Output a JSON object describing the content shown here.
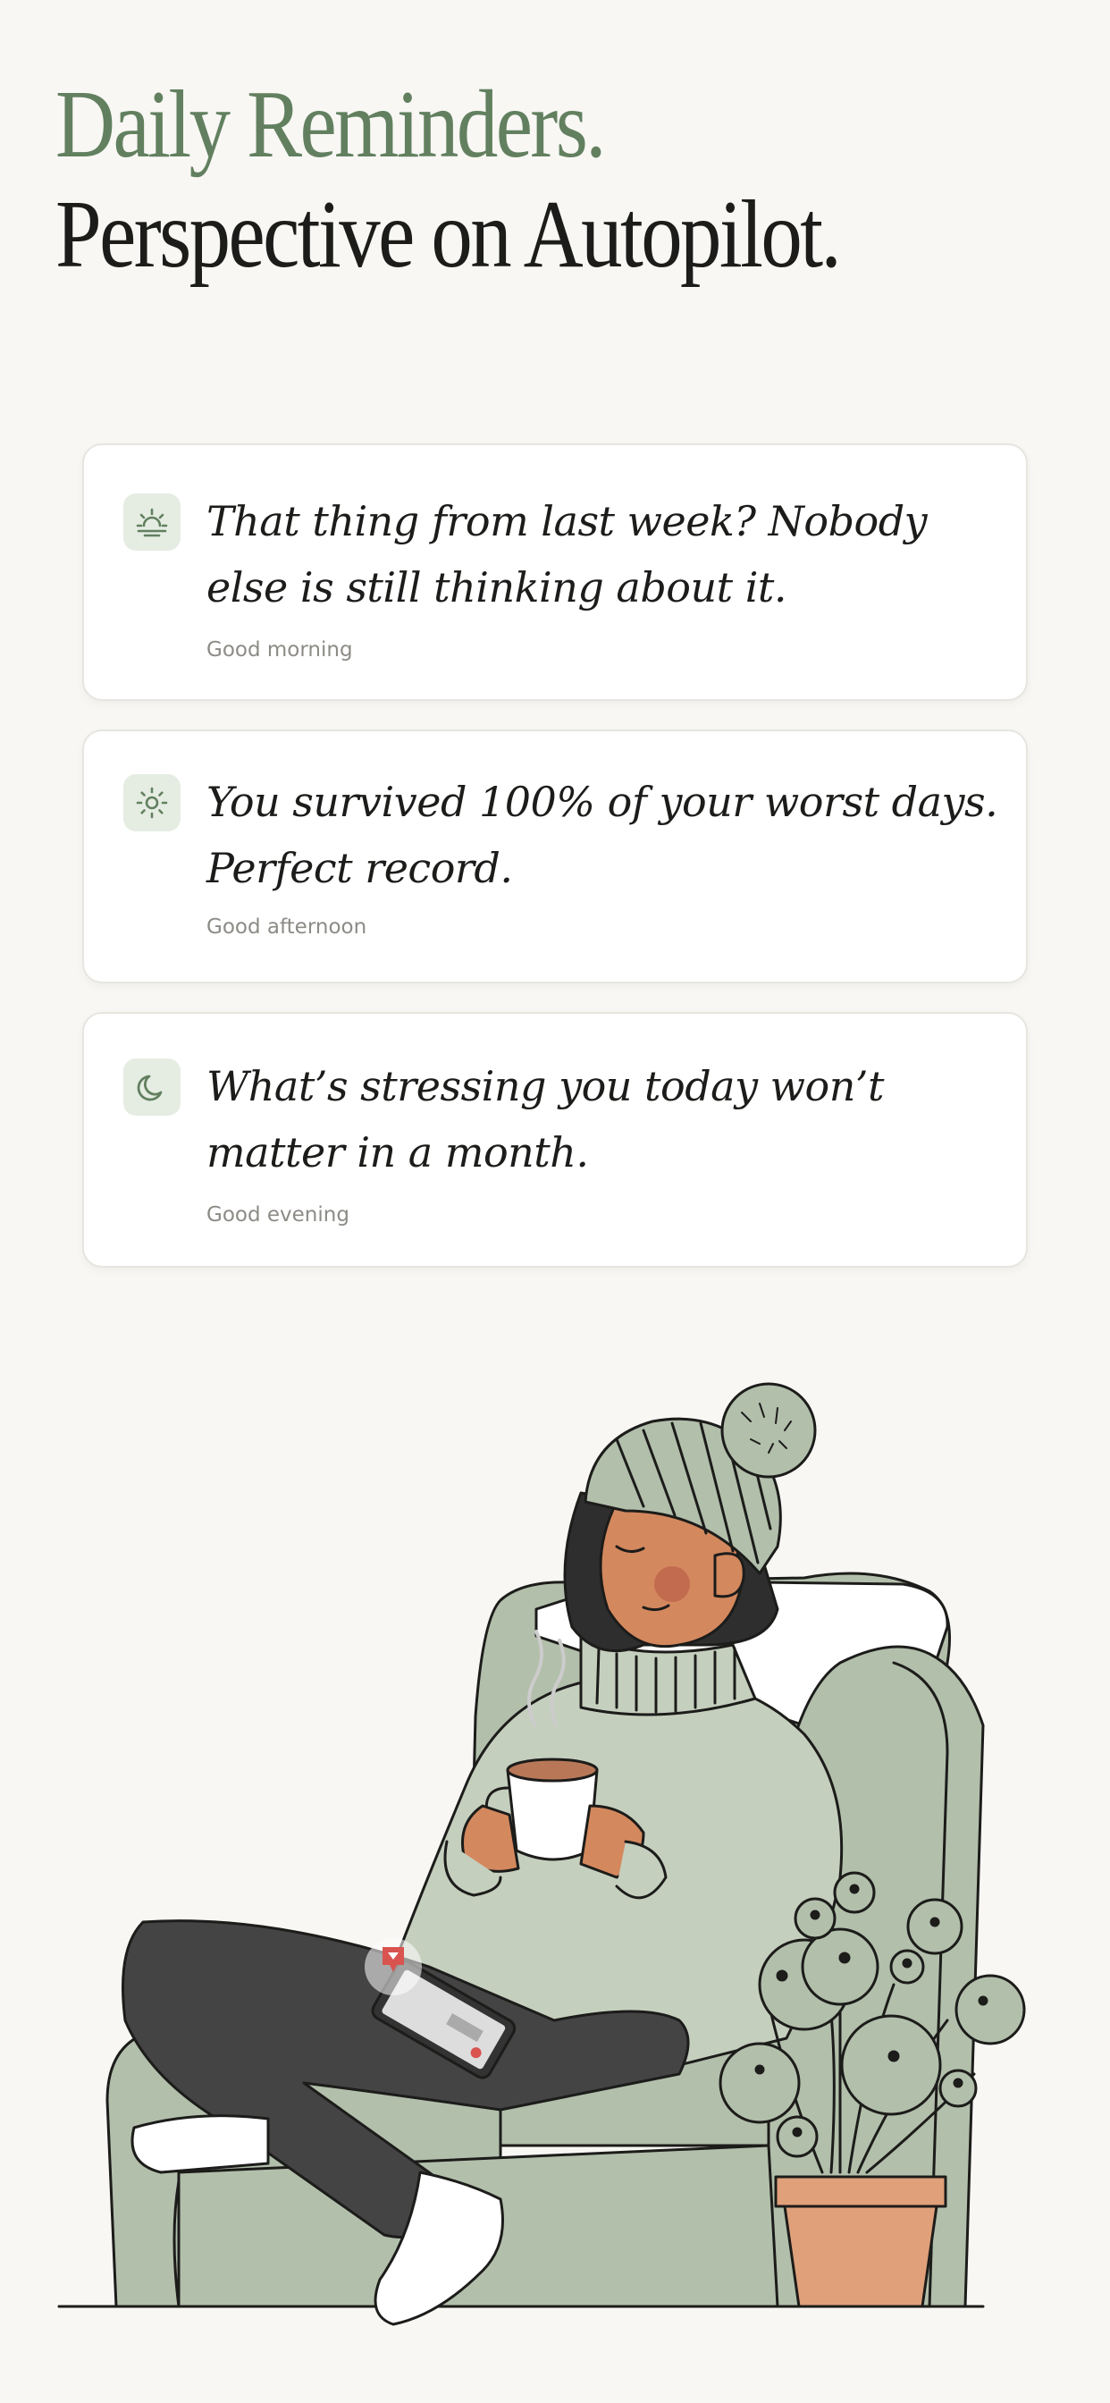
{
  "header": {
    "line1": "Daily Reminders.",
    "line2": "Perspective on Autopilot."
  },
  "reminders": [
    {
      "icon": "sunrise-icon",
      "text": "That thing from last week? Nobody else is still thinking about it.",
      "time_label": "Good morning"
    },
    {
      "icon": "sun-icon",
      "text": "You survived 100% of your worst days. Perfect record.",
      "time_label": "Good afternoon"
    },
    {
      "icon": "moon-icon",
      "text": "What’s stressing you today won’t matter in a month.",
      "time_label": "Good evening"
    }
  ],
  "colors": {
    "background": "#f8f7f4",
    "accent_green": "#62805f",
    "icon_bg": "#e5ede3",
    "text_dark": "#1c1c1a",
    "text_muted": "#8d8b86",
    "armchair": "#b2bfab",
    "sweater": "#c5cfbe",
    "pants": "#444444",
    "skin": "#d4885e",
    "pot": "#dfa07a",
    "notification": "#d9534f"
  }
}
